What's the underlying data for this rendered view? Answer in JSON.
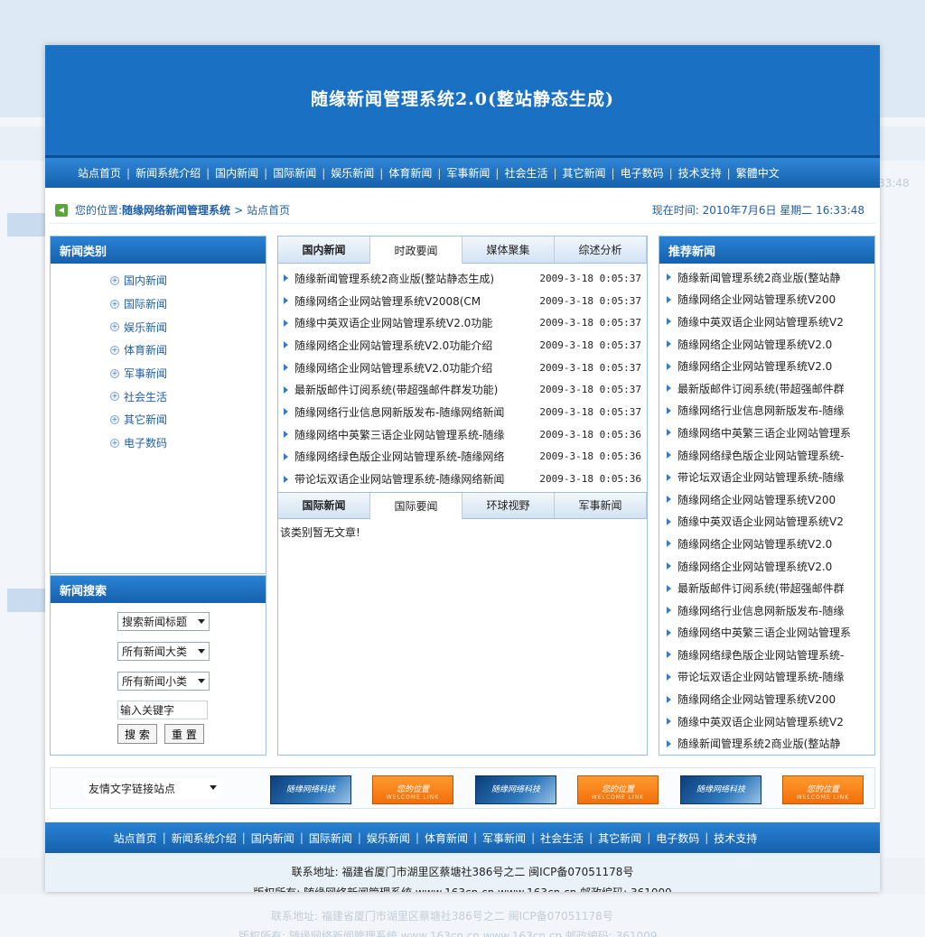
{
  "site": {
    "title": "随缘新闻管理系统2.0(整站静态生成)"
  },
  "nav": [
    "站点首页",
    "新闻系统介绍",
    "国内新闻",
    "国际新闻",
    "娱乐新闻",
    "体育新闻",
    "军事新闻",
    "社会生活",
    "其它新闻",
    "电子数码",
    "技术支持",
    "繁體中文"
  ],
  "location": {
    "label": "您的位置:",
    "current": "随缘网络新闻管理系统",
    "arrow": ">",
    "page": "站点首页",
    "clock": "现在时间: 2010年7月6日 星期二 16:33:48"
  },
  "categories": {
    "title": "新闻类别",
    "items": [
      "国内新闻",
      "国际新闻",
      "娱乐新闻",
      "体育新闻",
      "军事新闻",
      "社会生活",
      "其它新闻",
      "电子数码"
    ]
  },
  "search": {
    "title": "新闻搜索",
    "field": "搜索新闻标题",
    "big_class": "所有新闻大类",
    "small_class": "所有新闻小类",
    "keyword": "输入关键字",
    "search_btn": "搜 索",
    "reset_btn": "重 置"
  },
  "domestic": {
    "tabs": [
      "国内新闻",
      "时政要闻",
      "媒体聚集",
      "综述分析"
    ],
    "items": [
      {
        "title": "随缘新闻管理系统2商业版(整站静态生成)",
        "date": "2009-3-18 0:05:37"
      },
      {
        "title": "随缘网络企业网站管理系统V2008(CM",
        "date": "2009-3-18 0:05:37"
      },
      {
        "title": "随缘中英双语企业网站管理系统V2.0功能",
        "date": "2009-3-18 0:05:37"
      },
      {
        "title": "随缘网络企业网站管理系统V2.0功能介绍",
        "date": "2009-3-18 0:05:37"
      },
      {
        "title": "随缘网络企业网站管理系统V2.0功能介绍",
        "date": "2009-3-18 0:05:37"
      },
      {
        "title": "最新版邮件订阅系统(带超强邮件群发功能)",
        "date": "2009-3-18 0:05:37"
      },
      {
        "title": "随缘网络行业信息网新版发布-随缘网络新闻",
        "date": "2009-3-18 0:05:37"
      },
      {
        "title": "随缘网络中英繁三语企业网站管理系统-随缘",
        "date": "2009-3-18 0:05:36"
      },
      {
        "title": "随缘网络绿色版企业网站管理系统-随缘网络",
        "date": "2009-3-18 0:05:36"
      },
      {
        "title": "带论坛双语企业网站管理系统-随缘网络新闻",
        "date": "2009-3-18 0:05:36"
      }
    ]
  },
  "international": {
    "tabs": [
      "国际新闻",
      "国际要闻",
      "环球视野",
      "军事新闻"
    ],
    "empty": "该类别暂无文章!"
  },
  "recommended": {
    "title": "推荐新闻",
    "items": [
      "随缘新闻管理系统2商业版(整站静",
      "随缘网络企业网站管理系统V200",
      "随缘中英双语企业网站管理系统V2",
      "随缘网络企业网站管理系统V2.0",
      "随缘网络企业网站管理系统V2.0",
      "最新版邮件订阅系统(带超强邮件群",
      "随缘网络行业信息网新版发布-随缘",
      "随缘网络中英繁三语企业网站管理系",
      "随缘网络绿色版企业网站管理系统-",
      "带论坛双语企业网站管理系统-随缘",
      "随缘网络企业网站管理系统V200",
      "随缘中英双语企业网站管理系统V2",
      "随缘网络企业网站管理系统V2.0",
      "随缘网络企业网站管理系统V2.0",
      "最新版邮件订阅系统(带超强邮件群",
      "随缘网络行业信息网新版发布-随缘",
      "随缘网络中英繁三语企业网站管理系",
      "随缘网络绿色版企业网站管理系统-",
      "带论坛双语企业网站管理系统-随缘",
      "随缘网络企业网站管理系统V200",
      "随缘中英双语企业网站管理系统V2",
      "随缘新闻管理系统2商业版(整站静"
    ]
  },
  "links": {
    "select": "友情文字链接站点",
    "banners": [
      {
        "text": "随缘网络科技",
        "sub": ""
      },
      {
        "text": "您的位置",
        "sub": "WELCOME LINK"
      },
      {
        "text": "随缘网络科技",
        "sub": ""
      },
      {
        "text": "您的位置",
        "sub": "WELCOME LINK"
      },
      {
        "text": "随缘网络科技",
        "sub": ""
      },
      {
        "text": "您的位置",
        "sub": "WELCOME LINK"
      }
    ]
  },
  "footnav": [
    "站点首页",
    "新闻系统介绍",
    "国内新闻",
    "国际新闻",
    "娱乐新闻",
    "体育新闻",
    "军事新闻",
    "社会生活",
    "其它新闻",
    "电子数码",
    "技术支持"
  ],
  "footer": {
    "address": "联系地址: 福建省厦门市湖里区蔡塘社386号之二 闽ICP备07051178号",
    "copyright": "版权所有: 随缘网络新闻管理系统 www.163cn.cn www.163cn.cn 邮政编码: 361009"
  },
  "colors": {
    "brand_blue": "#1a71c4",
    "link_blue": "#1f5fa8",
    "banner_orange": "#f26e0a"
  }
}
